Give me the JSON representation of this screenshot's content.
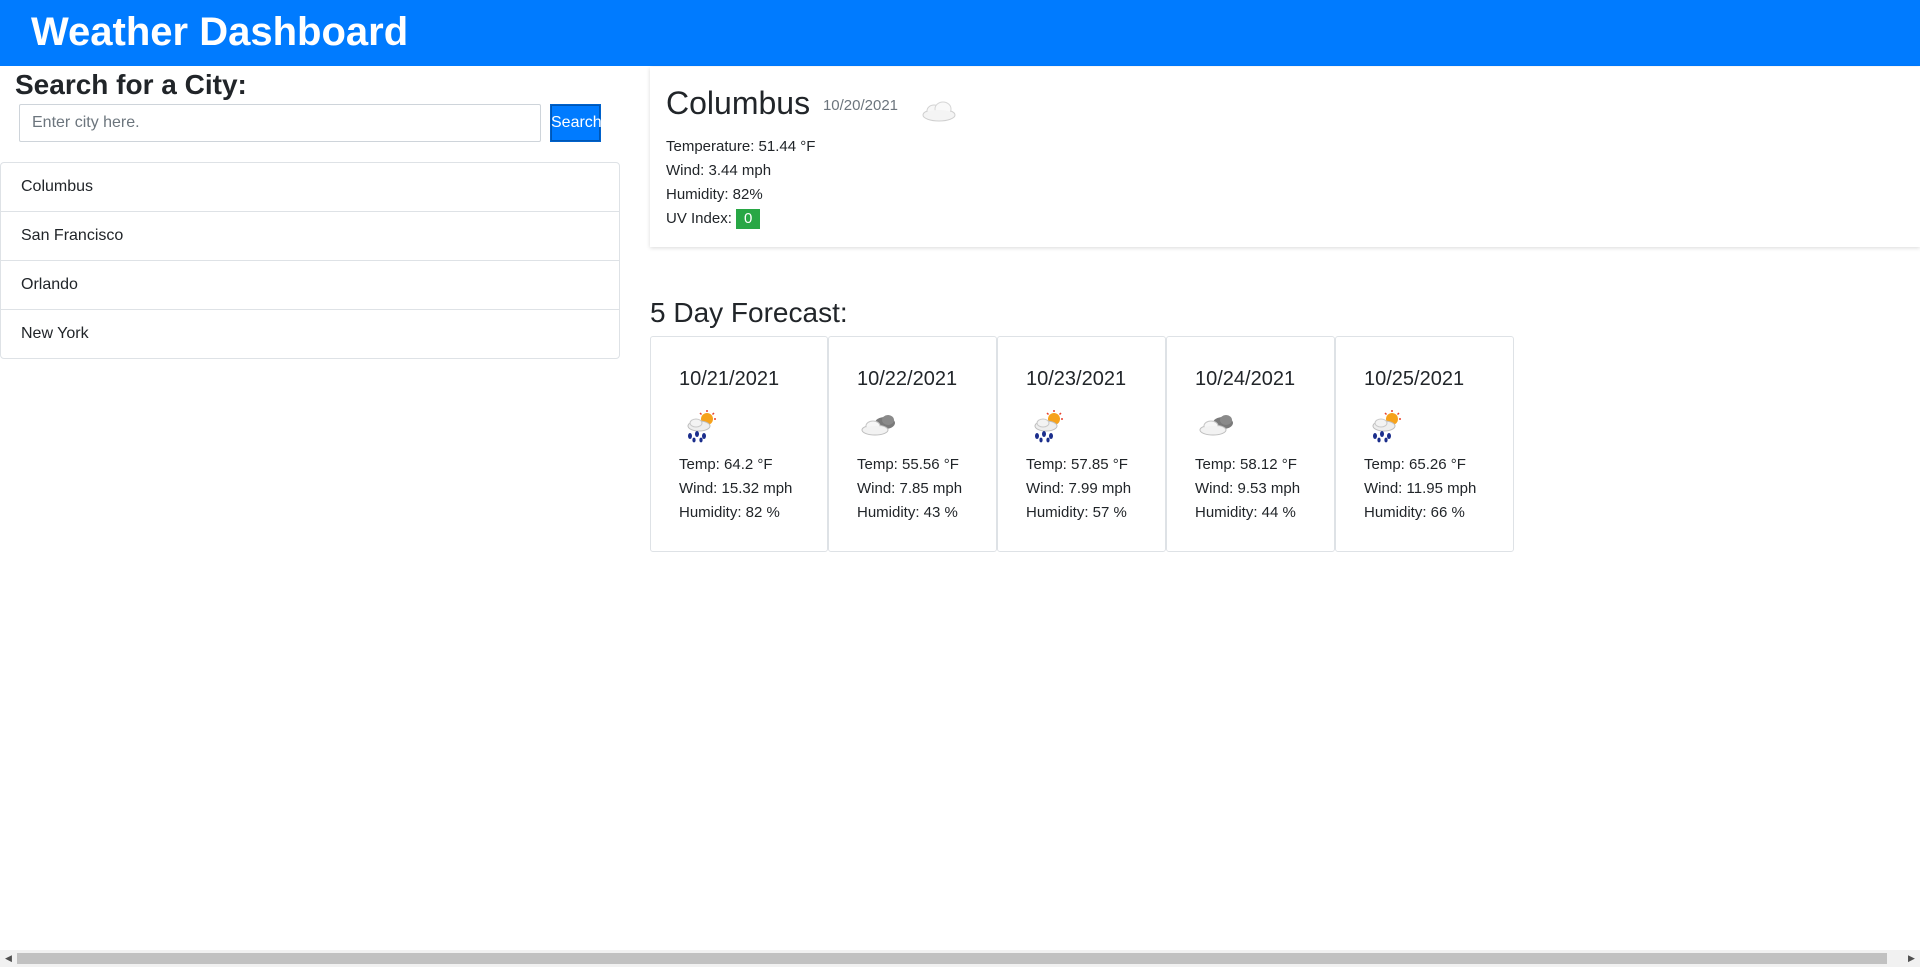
{
  "header": {
    "title": "Weather Dashboard"
  },
  "search": {
    "title": "Search for a City:",
    "placeholder": "Enter city here.",
    "button_label": "Search"
  },
  "history": [
    "Columbus",
    "San Francisco",
    "Orlando",
    "New York"
  ],
  "current": {
    "city": "Columbus",
    "date": "10/20/2021",
    "icon": "cloud-icon",
    "temperature": "Temperature: 51.44 °F",
    "wind": "Wind: 3.44 mph",
    "humidity": "Humidity: 82%",
    "uv_label": "UV Index: ",
    "uv_value": "0",
    "uv_color": "#28a745"
  },
  "forecast": {
    "title": "5 Day Forecast:",
    "days": [
      {
        "date": "10/21/2021",
        "icon": "rain-sun-icon",
        "temp": "Temp: 64.2 °F",
        "wind": "Wind: 15.32 mph",
        "humidity": "Humidity: 82 %"
      },
      {
        "date": "10/22/2021",
        "icon": "cloudy-icon",
        "temp": "Temp: 55.56 °F",
        "wind": "Wind: 7.85 mph",
        "humidity": "Humidity: 43 %"
      },
      {
        "date": "10/23/2021",
        "icon": "rain-sun-icon",
        "temp": "Temp: 57.85 °F",
        "wind": "Wind: 7.99 mph",
        "humidity": "Humidity: 57 %"
      },
      {
        "date": "10/24/2021",
        "icon": "cloudy-icon",
        "temp": "Temp: 58.12 °F",
        "wind": "Wind: 9.53 mph",
        "humidity": "Humidity: 44 %"
      },
      {
        "date": "10/25/2021",
        "icon": "rain-sun-icon",
        "temp": "Temp: 65.26 °F",
        "wind": "Wind: 11.95 mph",
        "humidity": "Humidity: 66 %"
      }
    ]
  },
  "colors": {
    "brand": "#007bff",
    "uv_low": "#28a745"
  }
}
